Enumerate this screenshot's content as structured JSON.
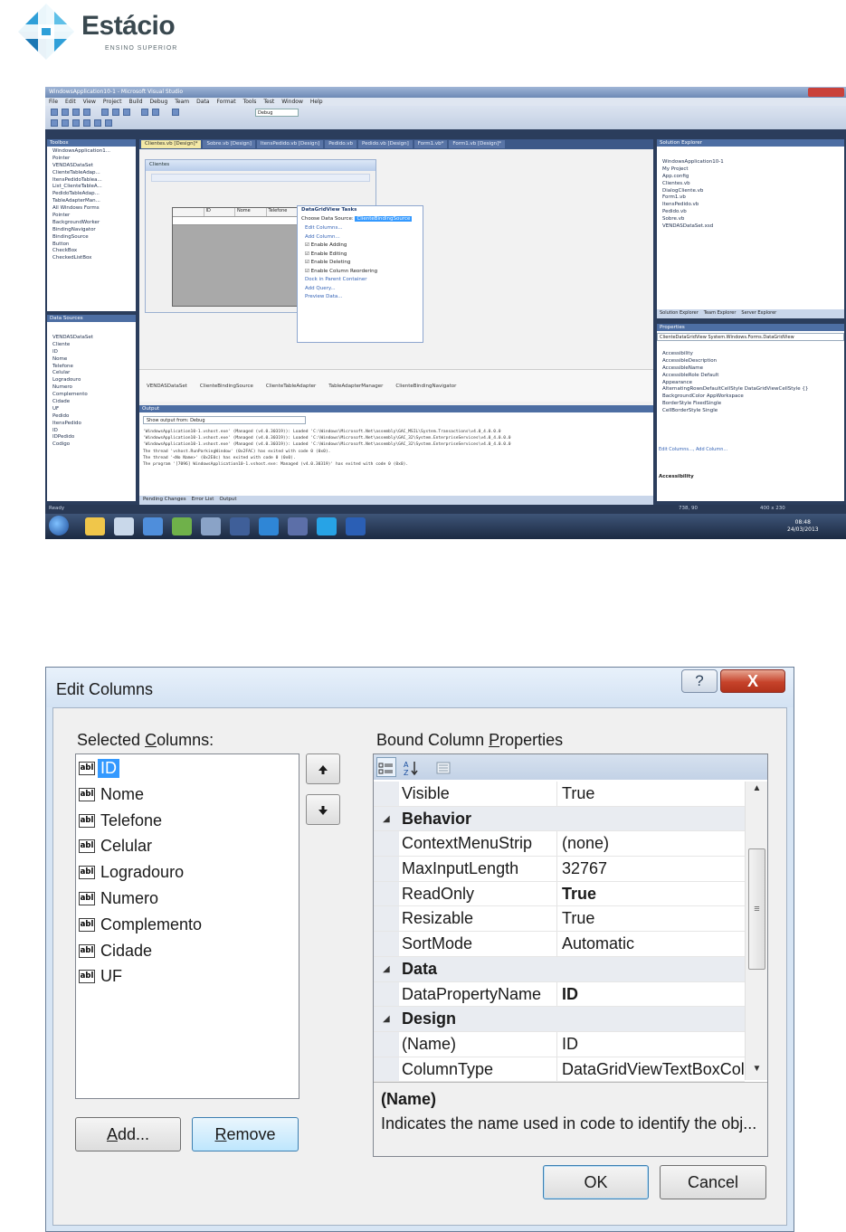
{
  "logo": {
    "name": "Estácio",
    "subtitle": "ENSINO SUPERIOR"
  },
  "vs_screenshot": {
    "window_title": "WindowsApplication10-1 - Microsoft Visual Studio",
    "menu": [
      "File",
      "Edit",
      "View",
      "Project",
      "Build",
      "Debug",
      "Team",
      "Data",
      "Format",
      "Tools",
      "Test",
      "Window",
      "Help"
    ],
    "toolbar_config": "Debug",
    "toolbox_title": "Toolbox",
    "toolbox_items": [
      "WindowsApplication1...",
      "Pointer",
      "VENDASDataSet",
      "ClienteTableAdap...",
      "ItensPedidoTablea...",
      "List_ClienteTableA...",
      "PedidoTableAdap...",
      "TableAdapterMan...",
      "All Windows Forms",
      "Pointer",
      "BackgroundWorker",
      "BindingNavigator",
      "BindingSource",
      "Button",
      "CheckBox",
      "CheckedListBox"
    ],
    "datasources_title": "Data Sources",
    "datasources_items": [
      "VENDASDataSet",
      "Cliente",
      "ID",
      "Nome",
      "Telefone",
      "Celular",
      "Logradouro",
      "Numero",
      "Complemento",
      "Cidade",
      "UF",
      "Pedido",
      "ItensPedido",
      "ID",
      "IDPedido",
      "Codigo"
    ],
    "doc_tabs": [
      "Clientes.vb [Design]*",
      "Sobre.vb [Design]",
      "ItensPedido.vb [Design]",
      "Pedido.vb",
      "Pedido.vb [Design]",
      "Form1.vb*",
      "Form1.vb [Design]*"
    ],
    "form_title": "Clientes",
    "grid_headers": [
      "ID",
      "Nome",
      "Telefone"
    ],
    "tasks": {
      "title": "DataGridView Tasks",
      "choose_source": "Choose Data Source:",
      "choose_value": "ClienteBindingSource",
      "links1": [
        "Edit Columns...",
        "Add Column..."
      ],
      "checks": [
        "Enable Adding",
        "Enable Editing",
        "Enable Deleting",
        "Enable Column Reordering"
      ],
      "links2": [
        "Dock in Parent Container",
        "Add Query...",
        "Preview Data..."
      ]
    },
    "tray_items": [
      "VENDASDataSet",
      "ClienteBindingSource",
      "ClienteTableAdapter",
      "TableAdapterManager",
      "ClienteBindingNavigator"
    ],
    "output_title": "Output",
    "output_show": "Show output from:  Debug",
    "output_lines": [
      "'WindowsApplication10-1.vshost.exe' (Managed (v4.0.30319)): Loaded 'C:\\Windows\\Microsoft.Net\\assembly\\GAC_MSIL\\System.Transactions\\v4.0_4.0.0.0",
      "'WindowsApplication10-1.vshost.exe' (Managed (v4.0.30319)): Loaded 'C:\\Windows\\Microsoft.Net\\assembly\\GAC_32\\System.EnterpriseServices\\v4.0_4.0.0.0",
      "'WindowsApplication10-1.vshost.exe' (Managed (v4.0.30319)): Loaded 'C:\\Windows\\Microsoft.Net\\assembly\\GAC_32\\System.EnterpriseServices\\v4.0_4.0.0.0",
      "The thread 'vshost.RunParkingWindow' (0x2FAC) has exited with code 0 (0x0).",
      "The thread '<No Name>' (0x2E0c) has exited with code 0 (0x0).",
      "The program '[7096] WindowsApplication10-1.vshost.exe: Managed (v4.0.30319)' has exited with code 0 (0x0)."
    ],
    "bottom_tabs": [
      "Pending Changes",
      "Error List",
      "Output"
    ],
    "solution_title": "Solution Explorer",
    "solution_items": [
      "WindowsApplication10-1",
      "My Project",
      "App.config",
      "Clientes.vb",
      "DialogCliente.vb",
      "Form1.vb",
      "ItensPedido.vb",
      "Pedido.vb",
      "Sobre.vb",
      "VENDASDataSet.xsd"
    ],
    "solution_tabs": [
      "Solution Explorer",
      "Team Explorer",
      "Server Explorer"
    ],
    "properties_title": "Properties",
    "properties_object": "ClienteDataGridView  System.Windows.Forms.DataGridView",
    "properties_rows": [
      "Accessibility",
      "AccessibleDescription",
      "AccessibleName",
      "AccessibleRole      Default",
      "Appearance",
      "AlternatingRowsDefaultCellStyle  DataGridViewCellStyle {}",
      "BackgroundColor    AppWorkspace",
      "BorderStyle    FixedSingle",
      "CellBorderStyle    Single"
    ],
    "properties_links": "Edit Columns..., Add Column...",
    "properties_desc": "Accessibility",
    "status_left": "Ready",
    "status_pos": "738, 90",
    "status_size": "400 x 230",
    "clock": "08:48",
    "date": "24/03/2013"
  },
  "dialog": {
    "title": "Edit Columns",
    "help_glyph": "?",
    "close_glyph": "X",
    "selected_columns_label": "Selected Columns:",
    "columns": [
      "ID",
      "Nome",
      "Telefone",
      "Celular",
      "Logradouro",
      "Numero",
      "Complemento",
      "Cidade",
      "UF"
    ],
    "column_icon_text": "abl",
    "bound_props_label": "Bound Column Properties",
    "props": [
      {
        "name": "Visible",
        "value": "True",
        "category": false,
        "bold": false
      },
      {
        "name": "Behavior",
        "value": "",
        "category": true,
        "bold": true
      },
      {
        "name": "ContextMenuStrip",
        "value": "(none)",
        "category": false,
        "bold": false
      },
      {
        "name": "MaxInputLength",
        "value": "32767",
        "category": false,
        "bold": false
      },
      {
        "name": "ReadOnly",
        "value": "True",
        "category": false,
        "bold": true
      },
      {
        "name": "Resizable",
        "value": "True",
        "category": false,
        "bold": false
      },
      {
        "name": "SortMode",
        "value": "Automatic",
        "category": false,
        "bold": false
      },
      {
        "name": "Data",
        "value": "",
        "category": true,
        "bold": true
      },
      {
        "name": "DataPropertyName",
        "value": "ID",
        "category": false,
        "bold": true
      },
      {
        "name": "Design",
        "value": "",
        "category": true,
        "bold": true
      },
      {
        "name": "(Name)",
        "value": "ID",
        "category": false,
        "bold": false
      },
      {
        "name": "ColumnType",
        "value": "DataGridViewTextBoxCol",
        "category": false,
        "bold": false
      }
    ],
    "desc_title": "(Name)",
    "desc_text": "Indicates the name used in code to identify the obj...",
    "add_label": "Add...",
    "remove_label": "Remove",
    "ok_label": "OK",
    "cancel_label": "Cancel"
  }
}
